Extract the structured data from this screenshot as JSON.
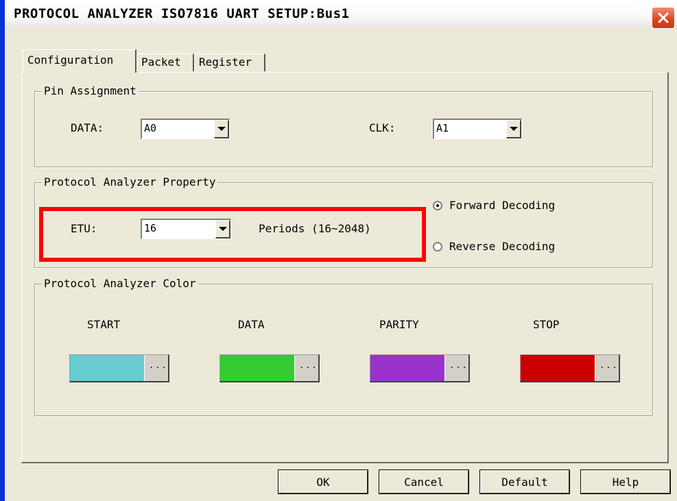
{
  "window": {
    "title": "PROTOCOL ANALYZER ISO7816 UART SETUP:Bus1",
    "close_icon": "close-icon"
  },
  "tabs": [
    {
      "label": "Configuration",
      "active": true
    },
    {
      "label": "Packet",
      "active": false
    },
    {
      "label": "Register",
      "active": false
    }
  ],
  "pin_assignment": {
    "title": "Pin Assignment",
    "data_label": "DATA:",
    "data_value": "A0",
    "clk_label": "CLK:",
    "clk_value": "A1"
  },
  "property": {
    "title": "Protocol Analyzer Property",
    "etu_label": "ETU:",
    "etu_value": "16",
    "periods_text": "Periods (16~2048)",
    "forward_label": "Forward Decoding",
    "reverse_label": "Reverse Decoding",
    "selected_decoding": "forward"
  },
  "colors": {
    "title": "Protocol Analyzer Color",
    "items": [
      {
        "label": "START",
        "color": "#66ccd0"
      },
      {
        "label": "DATA",
        "color": "#33cc33"
      },
      {
        "label": "PARITY",
        "color": "#9933cc"
      },
      {
        "label": "STOP",
        "color": "#cc0000"
      }
    ],
    "dots": "..."
  },
  "buttons": {
    "ok": "OK",
    "cancel": "Cancel",
    "default": "Default",
    "help": "Help"
  },
  "accents": {
    "highlight": "#ff0000",
    "titlebar_border": "#0831d9"
  }
}
